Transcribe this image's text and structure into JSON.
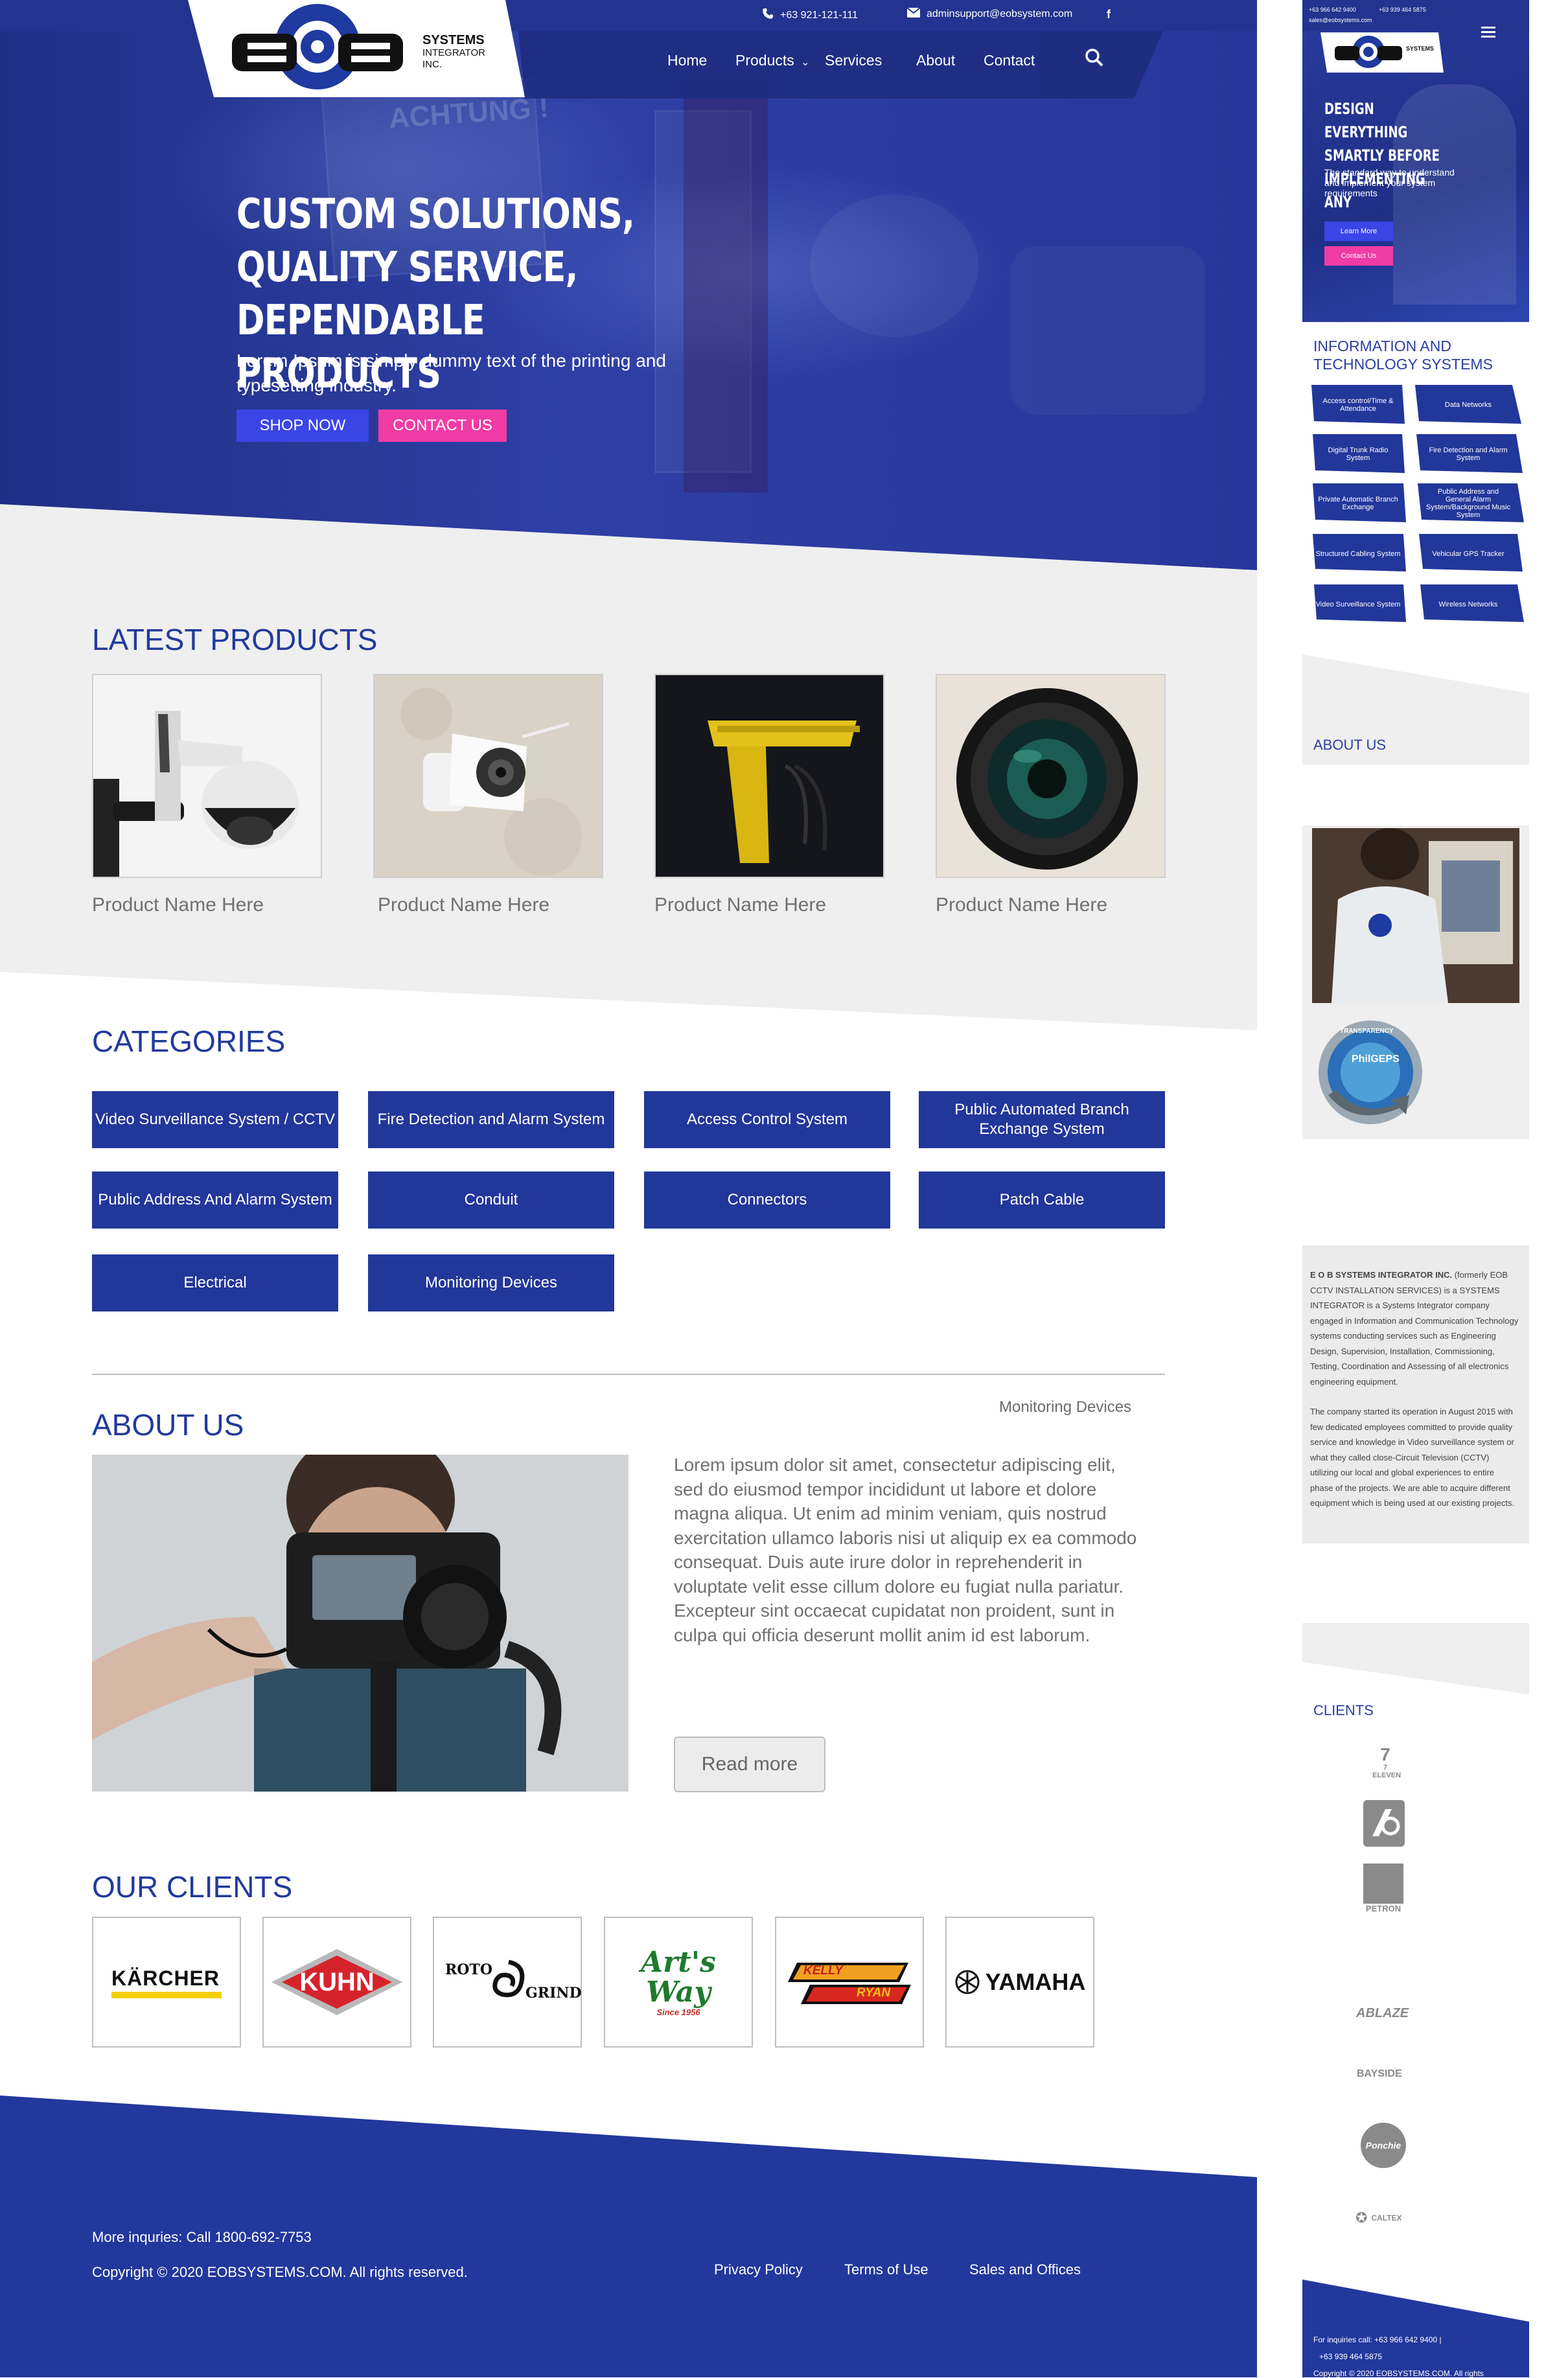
{
  "header": {
    "phone": "+63 921-121-111",
    "email": "adminsupport@eobsystem.com",
    "facebook_glyph": "f",
    "logo": {
      "letters": "EOB",
      "line1": "SYSTEMS",
      "line2": "INTEGRATOR",
      "line3": "INC."
    },
    "nav": [
      "Home",
      "Products",
      "Services",
      "About",
      "Contact"
    ]
  },
  "hero": {
    "title_lines": [
      "CUSTOM SOLUTIONS,",
      "QUALITY SERVICE,",
      "DEPENDABLE PRODUCTS"
    ],
    "subtitle": "Lorem Ipsum is simply dummy text of the printing and typesetting industry.",
    "shop_now": "SHOP NOW",
    "contact_us": "CONTACT US",
    "sign_text": "ACHTUNG !"
  },
  "latest_products": {
    "title": "LATEST PRODUCTS",
    "items": [
      {
        "name": "Product Name Here",
        "image": "ptz-dome-camera"
      },
      {
        "name": "Product Name Here",
        "image": "bullet-camera-on-wall"
      },
      {
        "name": "Product Name Here",
        "image": "yellow-mount"
      },
      {
        "name": "Product Name Here",
        "image": "camera-lens"
      }
    ]
  },
  "categories": {
    "title": "CATEGORIES",
    "items": [
      "Video Surveillance System / CCTV",
      "Fire Detection and Alarm System",
      "Access Control System",
      "Public Automated Branch Exchange System",
      "Public Address And Alarm System",
      "Conduit",
      "Connectors",
      "Patch Cable",
      "Electrical",
      "Monitoring Devices"
    ]
  },
  "about": {
    "corner_label": "Monitoring Devices",
    "title": "ABOUT US",
    "body": "Lorem ipsum dolor sit amet, consectetur adipiscing elit, sed do eiusmod tempor incididunt ut labore et dolore magna aliqua. Ut enim ad minim veniam, quis nostrud exercitation ullamco laboris nisi ut aliquip ex ea commodo consequat. Duis aute irure dolor in reprehenderit in voluptate velit esse cillum dolore eu fugiat nulla pariatur. Excepteur sint occaecat cupidatat non proident, sunt in culpa qui officia deserunt mollit anim id est laborum.",
    "read_more": "Read more"
  },
  "clients": {
    "title": "OUR CLIENTS",
    "items": [
      {
        "name": "KÄRCHER"
      },
      {
        "name": "KUHN"
      },
      {
        "name": "ROTO",
        "sub": "GRIND"
      },
      {
        "name": "Art's Way",
        "sub": "Since 1956"
      },
      {
        "name": "KELLY",
        "sub": "RYAN"
      },
      {
        "name": "YAMAHA"
      }
    ]
  },
  "footer": {
    "inquiries": "More inquries: Call 1800-692-7753",
    "copyright": "Copyright © 2020 EOBSYSTEMS.COM.  All rights reserved.",
    "links": [
      "Privacy Policy",
      "Terms of Use",
      "Sales and Offices"
    ]
  },
  "mobile": {
    "phone1": "+63 966 642 9400",
    "phone2": "+63 939 464 5875",
    "email": "sales@eobsystems.com",
    "hero_title": [
      "DESIGN EVERYTHING",
      "SMARTLY BEFORE",
      "IMPLEMENTING ANY"
    ],
    "hero_sub": "The standard way to understand and implement your system requirements",
    "learn_more": "Learn More",
    "contact_us": "Contact Us",
    "info_title": [
      "INFORMATION AND",
      "TECHNOLOGY SYSTEMS"
    ],
    "info_items": [
      "Access control/Time & Attendance",
      "Data Networks",
      "Digital Trunk Radio System",
      "Fire Detection and Alarm System",
      "Private Automatic Branch Exchange",
      "Public Address and General Alarm System/Background Music System",
      "Structured Cabling System",
      "Vehicular GPS Tracker",
      "Video Surveillance System",
      "Wireless Networks"
    ],
    "about_title": "ABOUT US",
    "badge": {
      "top": "TRANSPARENCY",
      "name": "PhilGEPS"
    },
    "about_lead": "E O B SYSTEMS INTEGRATOR INC.",
    "about_p1_rest": " (formerly EOB CCTV INSTALLATION SERVICES) is a SYSTEMS INTEGRATOR is a Systems Integrator company engaged in Information and Communication Technology systems conducting services such as Engineering Design, Supervision, Installation, Commissioning, Testing, Coordination and Assessing of all electronics engineering equipment.",
    "about_p2": "The company started its operation in August 2015 with few dedicated employees committed to provide quality service and knowledge in Video surveillance system or what they called close-Circuit Television (CCTV) utilizing our local and global experiences to entire phase of the projects. We are able to acquire different equipment which is being used at our existing projects.",
    "clients_title": "CLIENTS",
    "client_logos": [
      "7 ELEVEN",
      "",
      "PETRON",
      "ABLAZE",
      "BAYSIDE",
      "Ponchie",
      "CALTEX"
    ],
    "footer_line1": "For inquiries call:  +63 966 642 9400  |",
    "footer_line2": "+63 939 464 5875",
    "footer_line3": "Copyright © 2020 EOBSYSTEMS.COM. All rights"
  }
}
